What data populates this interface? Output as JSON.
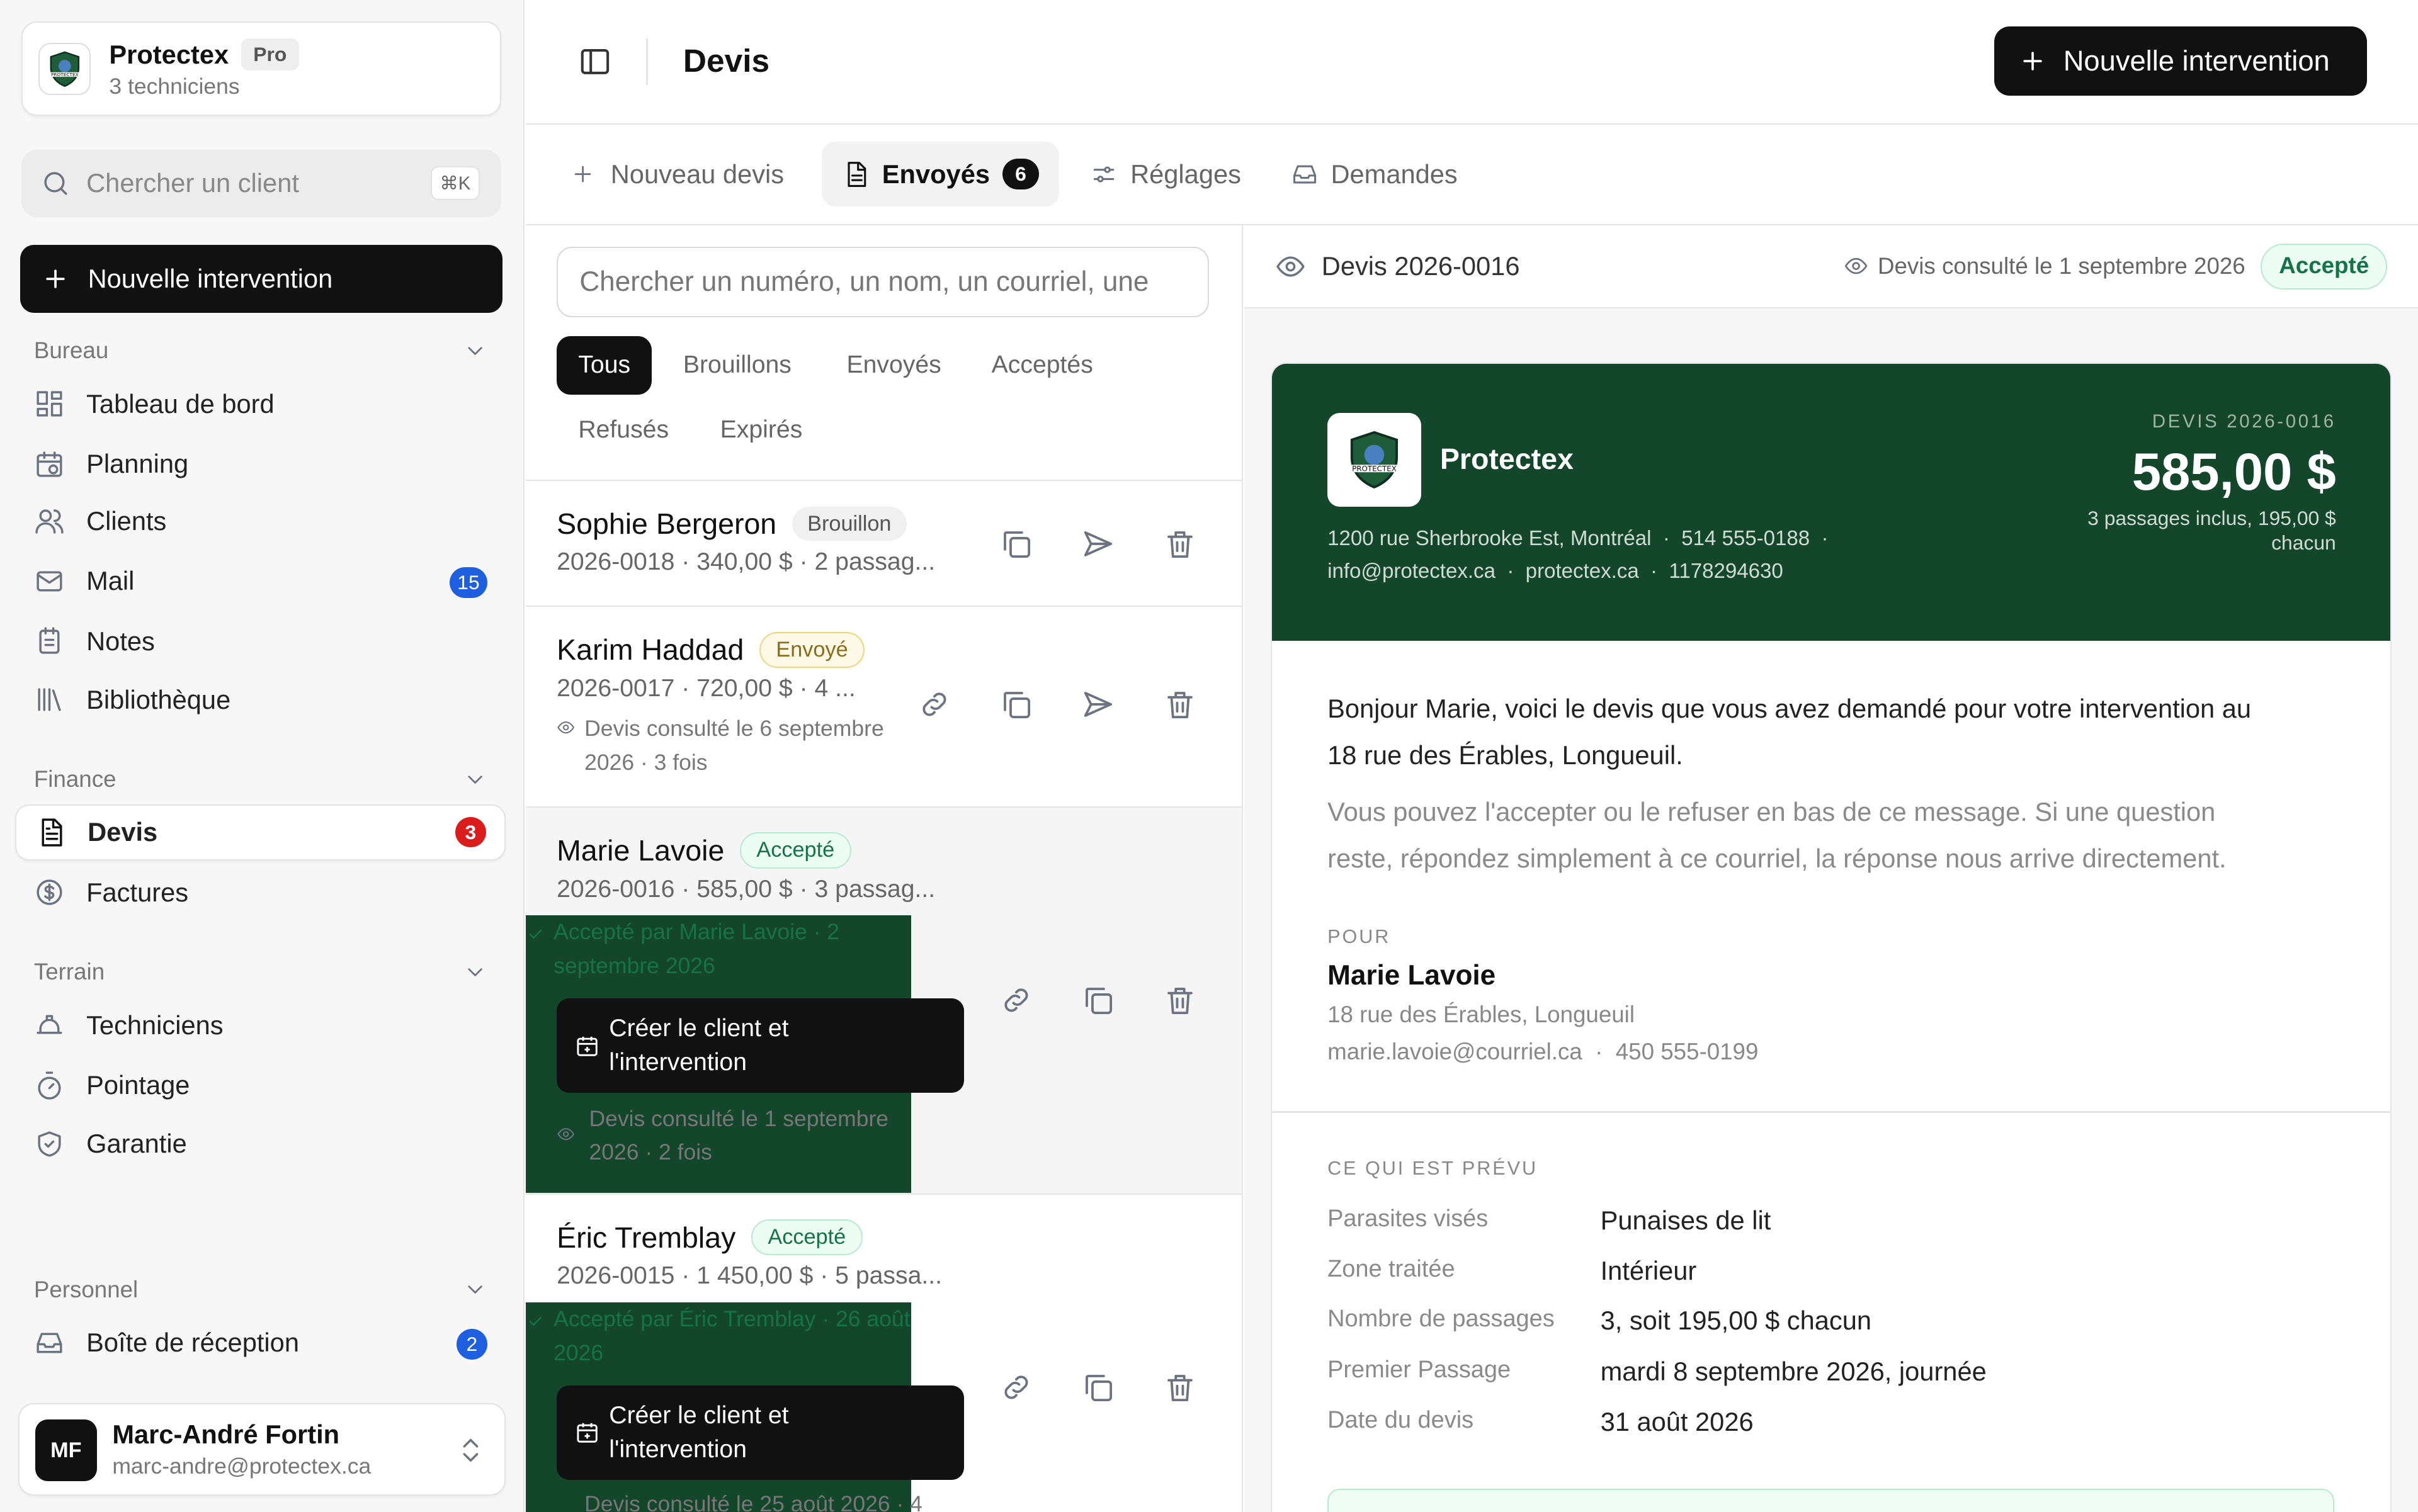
{
  "org": {
    "name": "Protectex",
    "plan": "Pro",
    "subtitle": "3 techniciens",
    "logo_text": "PROTECTEX"
  },
  "search": {
    "placeholder": "Chercher un client",
    "shortcut": "⌘K"
  },
  "sidebar_cta": "Nouvelle intervention",
  "sections": {
    "bureau": {
      "label": "Bureau",
      "items": [
        {
          "label": "Tableau de bord",
          "icon": "dashboard-icon"
        },
        {
          "label": "Planning",
          "icon": "calendar-icon"
        },
        {
          "label": "Clients",
          "icon": "users-icon"
        },
        {
          "label": "Mail",
          "icon": "mail-icon",
          "badge": "15"
        },
        {
          "label": "Notes",
          "icon": "notes-icon"
        },
        {
          "label": "Bibliothèque",
          "icon": "library-icon"
        }
      ]
    },
    "finance": {
      "label": "Finance",
      "items": [
        {
          "label": "Devis",
          "icon": "document-icon",
          "badge": "3"
        },
        {
          "label": "Factures",
          "icon": "dollar-icon"
        }
      ]
    },
    "terrain": {
      "label": "Terrain",
      "items": [
        {
          "label": "Techniciens",
          "icon": "hardhat-icon"
        },
        {
          "label": "Pointage",
          "icon": "timer-icon"
        },
        {
          "label": "Garantie",
          "icon": "shield-icon"
        }
      ]
    },
    "personnel": {
      "label": "Personnel",
      "items": [
        {
          "label": "Boîte de réception",
          "icon": "inbox-icon",
          "badge": "2"
        }
      ]
    }
  },
  "user": {
    "initials": "MF",
    "name": "Marc-André Fortin",
    "email": "marc-andre@protectex.ca"
  },
  "header": {
    "title": "Devis",
    "cta": "Nouvelle intervention"
  },
  "tabs": [
    {
      "label": "Nouveau devis"
    },
    {
      "label": "Envoyés",
      "count": "6"
    },
    {
      "label": "Réglages"
    },
    {
      "label": "Demandes"
    }
  ],
  "list": {
    "search_placeholder": "Chercher un numéro, un nom, un courriel, une",
    "filters": [
      "Tous",
      "Brouillons",
      "Envoyés",
      "Acceptés",
      "Refusés",
      "Expirés"
    ],
    "rows": [
      {
        "name": "Sophie Bergeron",
        "status": "Brouillon",
        "meta": "2026-0018 · 340,00 $ · 2 passag..."
      },
      {
        "name": "Karim Haddad",
        "status": "Envoyé",
        "meta": "2026-0017 · 720,00 $ · 4 ...",
        "note": "Devis consulté le 6 septembre 2026 · 3 fois"
      },
      {
        "name": "Marie Lavoie",
        "status": "Accepté",
        "meta": "2026-0016 · 585,00 $ · 3 passag...",
        "accepted": "Accepté par Marie Lavoie · 2 septembre 2026",
        "button": "Créer le client et l'intervention",
        "note": "Devis consulté le 1 septembre 2026 · 2 fois"
      },
      {
        "name": "Éric Tremblay",
        "status": "Accepté",
        "meta": "2026-0015 · 1 450,00 $ · 5 passa...",
        "accepted": "Accepté par Éric Tremblay · 26 août 2026",
        "button": "Créer le client et l'intervention",
        "note": "Devis consulté le 25 août 2026 · 4"
      }
    ]
  },
  "detail": {
    "number": "Devis 2026-0016",
    "viewed": "Devis consulté le 1 septembre 2026",
    "status": "Accepté",
    "company": "Protectex",
    "address_line1": "1200 rue Sherbrooke Est, Montréal  ·  514 555-0188  ·",
    "address_line2": "info@protectex.ca  ·  protectex.ca  ·  1178294630",
    "devis_label": "DEVIS 2026-0016",
    "amount": "585,00 $",
    "amount_sub1": "3 passages inclus, 195,00 $",
    "amount_sub2": "chacun",
    "intro1": "Bonjour Marie, voici le devis que vous avez demandé pour votre intervention au",
    "intro2": "18 rue des Érables, Longueuil.",
    "body1": "Vous pouvez l'accepter ou le refuser en bas de ce message. Si une question",
    "body2": "reste, répondez simplement à ce courriel, la réponse nous arrive directement.",
    "pour_label": "POUR",
    "client_name": "Marie Lavoie",
    "client_address": "18 rue des Érables, Longueuil",
    "client_contact": "marie.lavoie@courriel.ca  ·  450 555-0199",
    "plan_label": "CE QUI EST PRÉVU",
    "plan": [
      {
        "k": "Parasites visés",
        "v": "Punaises de lit"
      },
      {
        "k": "Zone traitée",
        "v": "Intérieur"
      },
      {
        "k": "Nombre de passages",
        "v": "3, soit 195,00 $ chacun"
      },
      {
        "k": "Premier Passage",
        "v": "mardi 8 septembre 2026, journée"
      },
      {
        "k": "Date du devis",
        "v": "31 août 2026"
      }
    ]
  },
  "colors": {
    "accent_green": "#14462c",
    "badge_blue": "#1d5fe0",
    "badge_red": "#dc1c1c",
    "accepted_green": "#157347"
  }
}
